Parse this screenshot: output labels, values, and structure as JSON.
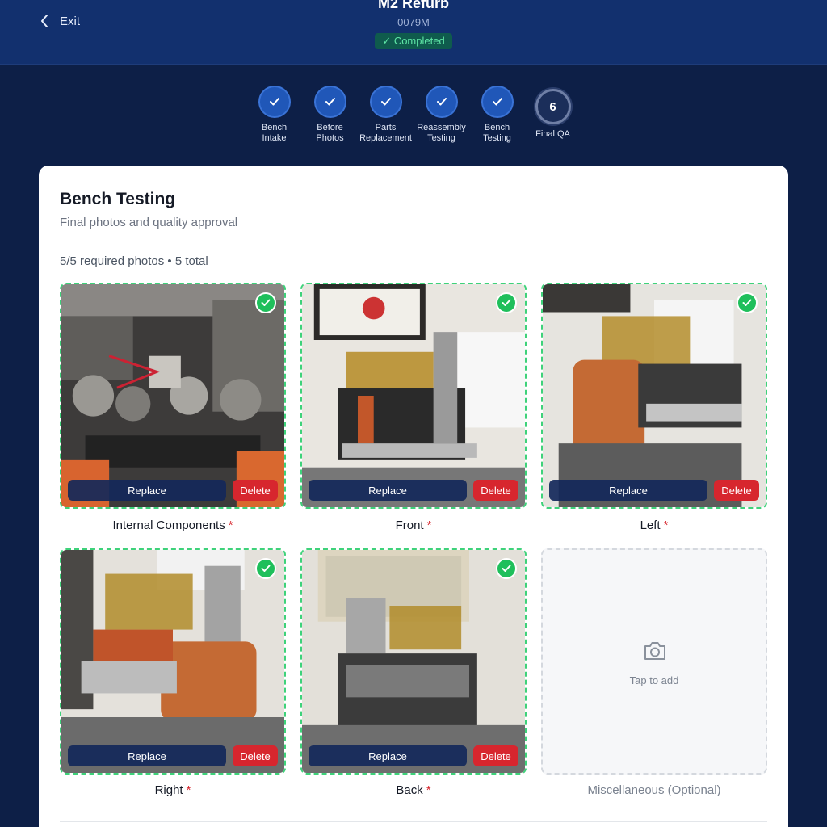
{
  "header": {
    "exit_label": "Exit",
    "title": "M2 Refurb",
    "subtitle": "0079M",
    "status": "✓ Completed"
  },
  "stepper": {
    "steps": [
      {
        "label": "Bench\nIntake",
        "state": "done"
      },
      {
        "label": "Before\nPhotos",
        "state": "done"
      },
      {
        "label": "Parts\nReplacement",
        "state": "done"
      },
      {
        "label": "Reassembly\nTesting",
        "state": "done"
      },
      {
        "label": "Bench\nTesting",
        "state": "done"
      },
      {
        "label": "Final QA",
        "state": "current",
        "number": "6"
      }
    ]
  },
  "card": {
    "title": "Bench Testing",
    "subtitle": "Final photos and quality approval",
    "count": "5/5 required photos • 5 total"
  },
  "photos": [
    {
      "label": "Internal Components",
      "required": "*",
      "replace": "Replace",
      "delete": "Delete"
    },
    {
      "label": "Front",
      "required": "*",
      "replace": "Replace",
      "delete": "Delete"
    },
    {
      "label": "Left",
      "required": "*",
      "replace": "Replace",
      "delete": "Delete"
    },
    {
      "label": "Right",
      "required": "*",
      "replace": "Replace",
      "delete": "Delete"
    },
    {
      "label": "Back",
      "required": "*",
      "replace": "Replace",
      "delete": "Delete"
    }
  ],
  "add_tile": {
    "text": "Tap to add",
    "label": "Miscellaneous (Optional)",
    "icon": "camera-icon"
  },
  "colors": {
    "background": "#0d1f47",
    "header": "#12306e",
    "step_done": "#2057b8",
    "success": "#1fbf5b",
    "danger": "#d7262e"
  }
}
